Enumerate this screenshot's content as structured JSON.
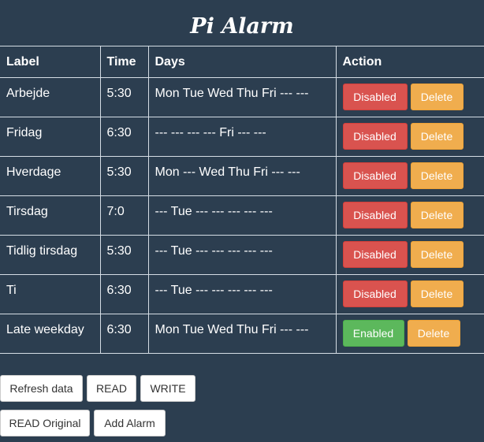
{
  "app": {
    "title": "Pi Alarm"
  },
  "table": {
    "headers": {
      "label": "Label",
      "time": "Time",
      "days": "Days",
      "action": "Action"
    },
    "rows": [
      {
        "label": "Arbejde",
        "time": "5:30",
        "days": "Mon Tue Wed Thu Fri --- ---",
        "status": "Disabled",
        "delete": "Delete"
      },
      {
        "label": "Fridag",
        "time": "6:30",
        "days": "--- --- --- --- Fri --- ---",
        "status": "Disabled",
        "delete": "Delete"
      },
      {
        "label": "Hverdage",
        "time": "5:30",
        "days": "Mon --- Wed Thu Fri --- ---",
        "status": "Disabled",
        "delete": "Delete"
      },
      {
        "label": "Tirsdag",
        "time": "7:0",
        "days": "--- Tue --- --- --- --- ---",
        "status": "Disabled",
        "delete": "Delete"
      },
      {
        "label": "Tidlig tirsdag",
        "time": "5:30",
        "days": "--- Tue --- --- --- --- ---",
        "status": "Disabled",
        "delete": "Delete"
      },
      {
        "label": "Ti",
        "time": "6:30",
        "days": "--- Tue --- --- --- --- ---",
        "status": "Disabled",
        "delete": "Delete"
      },
      {
        "label": "Late weekday",
        "time": "6:30",
        "days": "Mon Tue Wed Thu Fri --- ---",
        "status": "Enabled",
        "delete": "Delete"
      }
    ]
  },
  "controls": {
    "refresh": "Refresh data",
    "read": "READ",
    "write": "WRITE",
    "read_original": "READ Original",
    "add_alarm": "Add Alarm"
  },
  "colors": {
    "background": "#2c3e50",
    "disabled": "#d9534f",
    "enabled": "#5cb85c",
    "delete": "#f0ad4e"
  }
}
